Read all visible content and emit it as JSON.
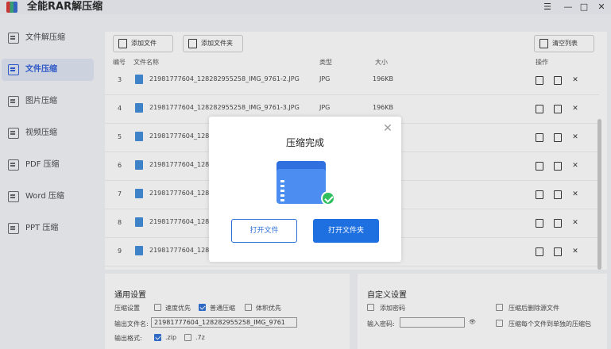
{
  "app": {
    "title": "全能RAR解压缩",
    "menu_glyph": "☰",
    "min_glyph": "—",
    "max_glyph": "□",
    "close_glyph": "✕"
  },
  "sidebar": {
    "items": [
      {
        "label": "文件解压缩"
      },
      {
        "label": "文件压缩"
      },
      {
        "label": "图片压缩"
      },
      {
        "label": "视频压缩"
      },
      {
        "label": "PDF 压缩"
      },
      {
        "label": "Word 压缩"
      },
      {
        "label": "PPT 压缩"
      }
    ],
    "active_index": 1
  },
  "toolbar": {
    "add_file": "添加文件",
    "add_folder": "添加文件夹",
    "clear_list": "清空列表"
  },
  "table": {
    "headers": {
      "num": "编号",
      "name": "文件名称",
      "type": "类型",
      "size": "大小",
      "action": "操作"
    },
    "rows": [
      {
        "num": "3",
        "name": "21981777604_128282955258_IMG_9761-2.JPG",
        "type": "JPG",
        "size": "196KB"
      },
      {
        "num": "4",
        "name": "21981777604_128282955258_IMG_9761-3.JPG",
        "type": "JPG",
        "size": "196KB"
      },
      {
        "num": "5",
        "name": "21981777604_12828",
        "type": "",
        "size": ""
      },
      {
        "num": "6",
        "name": "21981777604_12828",
        "type": "",
        "size": ""
      },
      {
        "num": "7",
        "name": "21981777604_12828",
        "type": "",
        "size": ""
      },
      {
        "num": "8",
        "name": "21981777604_12828",
        "type": "",
        "size": ""
      },
      {
        "num": "9",
        "name": "21981777604_12828",
        "type": "",
        "size": ""
      }
    ]
  },
  "general_settings": {
    "title": "通用设置",
    "compress_label": "压缩设置",
    "speed_first": "速度优先",
    "normal": "普通压缩",
    "size_first": "体积优先",
    "output_name_label": "输出文件名:",
    "output_name_value": "21981777604_128282955258_IMG_9761",
    "format_label": "输出格式:",
    "zip": ".zip",
    "sevenz": ".7z"
  },
  "custom_settings": {
    "title": "自定义设置",
    "add_password": "添加密码",
    "delete_source": "压缩后删除源文件",
    "password_label": "输入密码:",
    "per_file": "压缩每个文件到单独的压缩包"
  },
  "dialog": {
    "title": "压缩完成",
    "close_glyph": "✕",
    "open_file": "打开文件",
    "open_folder": "打开文件夹"
  },
  "colors": {
    "accent": "#1e6fe0",
    "success": "#2fbf5f",
    "folder": "#4c8df2"
  }
}
